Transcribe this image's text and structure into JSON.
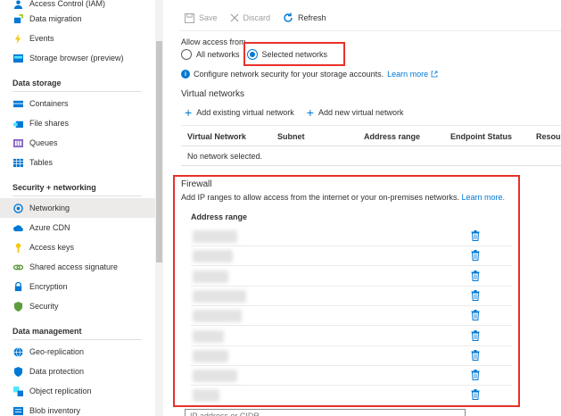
{
  "sidebar": {
    "items_top": [
      {
        "label": "Access Control (IAM)",
        "icon": "people-icon"
      },
      {
        "label": "Data migration",
        "icon": "migration-icon"
      },
      {
        "label": "Events",
        "icon": "lightning-icon"
      },
      {
        "label": "Storage browser (preview)",
        "icon": "storage-browser-icon"
      }
    ],
    "sections": [
      {
        "title": "Data storage",
        "items": [
          {
            "label": "Containers"
          },
          {
            "label": "File shares"
          },
          {
            "label": "Queues"
          },
          {
            "label": "Tables"
          }
        ]
      },
      {
        "title": "Security + networking",
        "items": [
          {
            "label": "Networking"
          },
          {
            "label": "Azure CDN"
          },
          {
            "label": "Access keys"
          },
          {
            "label": "Shared access signature"
          },
          {
            "label": "Encryption"
          },
          {
            "label": "Security"
          }
        ]
      },
      {
        "title": "Data management",
        "items": [
          {
            "label": "Geo-replication"
          },
          {
            "label": "Data protection"
          },
          {
            "label": "Object replication"
          },
          {
            "label": "Blob inventory"
          }
        ]
      }
    ]
  },
  "toolbar": {
    "save_label": "Save",
    "discard_label": "Discard",
    "refresh_label": "Refresh"
  },
  "access": {
    "label": "Allow access from",
    "options": [
      "All networks",
      "Selected networks"
    ],
    "selected": "Selected networks",
    "info_text": "Configure network security for your storage accounts.",
    "learn_more": "Learn more"
  },
  "virtual_networks": {
    "title": "Virtual networks",
    "add_existing": "Add existing virtual network",
    "add_new": "Add new virtual network",
    "columns": [
      "Virtual Network",
      "Subnet",
      "Address range",
      "Endpoint Status",
      "Resour"
    ],
    "empty_text": "No network selected."
  },
  "firewall": {
    "title": "Firewall",
    "description": "Add IP ranges to allow access from the internet or your on-premises networks.",
    "learn_more": "Learn more.",
    "column": "Address range",
    "row_count": 9,
    "input_placeholder": "IP address or CIDR"
  },
  "colors": {
    "accent": "#0078d4",
    "highlight": "#e8312a"
  }
}
